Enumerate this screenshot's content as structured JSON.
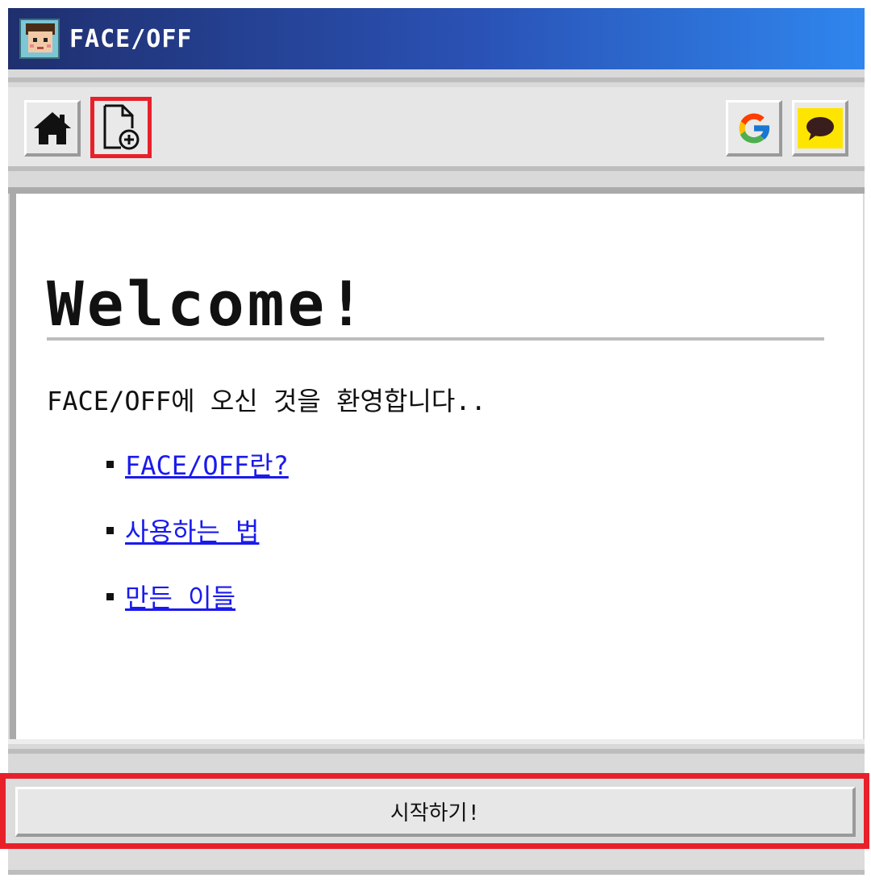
{
  "app": {
    "title": "FACE/OFF"
  },
  "toolbar": {
    "buttons": [
      {
        "name": "home",
        "icon": "home-icon"
      },
      {
        "name": "new-document",
        "icon": "file-plus-icon"
      },
      {
        "name": "google",
        "icon": "google-icon"
      },
      {
        "name": "kakaotalk",
        "icon": "kakao-chat-icon"
      }
    ]
  },
  "main": {
    "heading": "Welcome!",
    "intro": "FACE/OFF에 오신 것을 환영합니다..",
    "links": [
      {
        "label": "FACE/OFF란?"
      },
      {
        "label": "사용하는 법"
      },
      {
        "label": "만든 이들"
      }
    ]
  },
  "footer": {
    "start_label": "시작하기!"
  },
  "colors": {
    "titlebar_start": "#1f2f6e",
    "titlebar_end": "#2f86ee",
    "highlight": "#e8202a",
    "link": "#1a1aee",
    "kakao_yellow": "#fee500"
  }
}
